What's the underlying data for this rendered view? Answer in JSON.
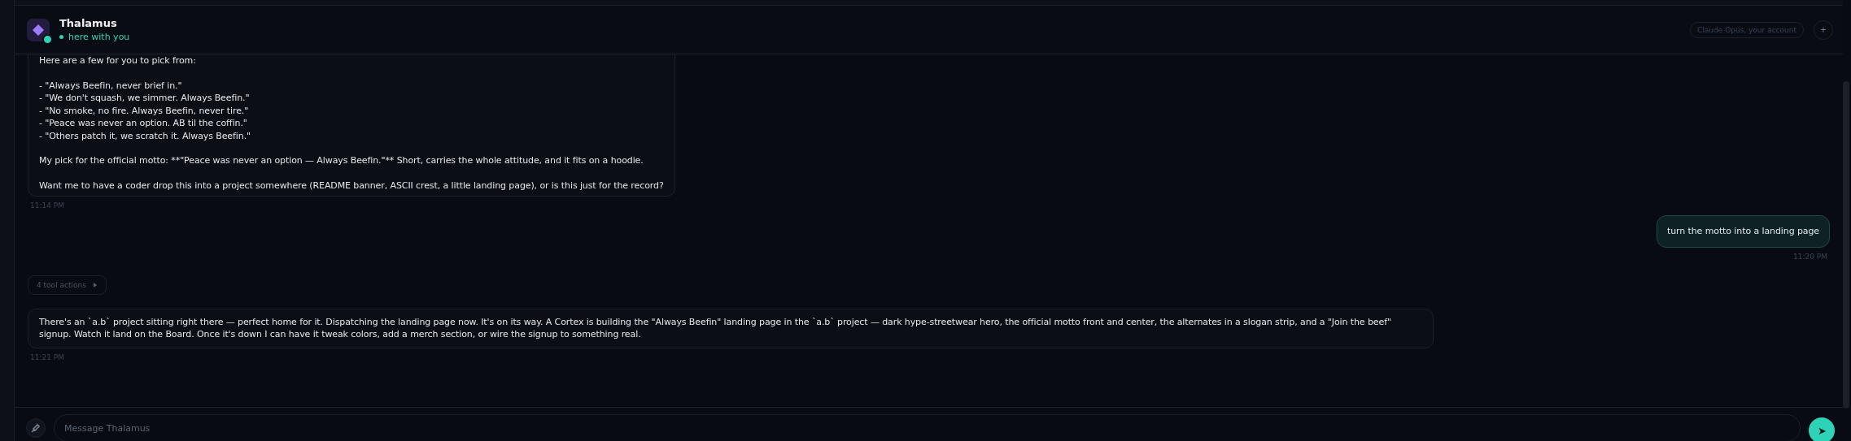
{
  "header": {
    "title": "Thalamus",
    "status": "here with you",
    "online": true,
    "account": "Claude Opus, your account",
    "add_button": "+"
  },
  "messages": [
    {
      "kind": "assistant",
      "paragraphs": [
        "Here are a few for you to pick from:",
        "- \"Always Beefin, never brief in.\"\n- \"We don't squash, we simmer. Always Beefin.\"\n- \"No smoke, no fire. Always Beefin, never tire.\"\n- \"Peace was never an option. AB til the coffin.\"\n- \"Others patch it, we scratch it. Always Beefin.\"",
        "My pick for the official motto: **\"Peace was never an option — Always Beefin.\"** Short, carries the whole attitude, and it fits on a hoodie.",
        "Want me to have a coder drop this into a project somewhere (README banner, ASCII crest, a little landing page), or is this just for the record?"
      ],
      "time": "11:14 PM"
    },
    {
      "kind": "user",
      "paragraphs": [
        "turn the motto into a landing page"
      ],
      "time": "11:20 PM"
    },
    {
      "kind": "tools",
      "label": "4 tool actions",
      "expanded": false
    },
    {
      "kind": "assistant",
      "paragraphs": [
        "There's an `a.b` project sitting right there — perfect home for it. Dispatching the landing page now. It's on its way. A Cortex is building the \"Always Beefin\" landing page in the `a.b` project — dark hype-streetwear hero, the official motto front and center, the alternates in a slogan strip, and a \"Join the beef\" signup. Watch it land on the Board. Once it's down I can have it tweak colors, add a merch section, or wire the signup to something real."
      ],
      "time": "11:21 PM"
    }
  ],
  "composer": {
    "placeholder": "Message Thalamus",
    "send": "➤"
  }
}
